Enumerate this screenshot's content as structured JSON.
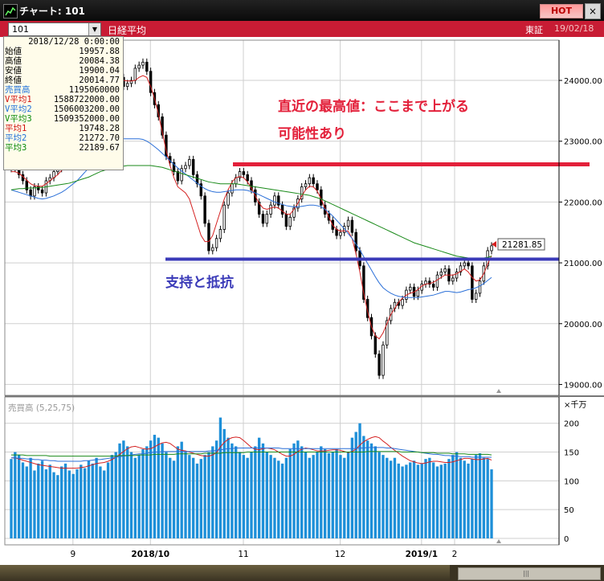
{
  "window": {
    "title": "チャート: 101",
    "hot_badge": "HOT",
    "close": "×"
  },
  "toolbar": {
    "symbol": "101",
    "index_name": "日経平均",
    "market": "東証",
    "date": "19/02/18"
  },
  "info_panel": {
    "date": "2018/12/28 0:00:00",
    "rows": [
      {
        "label": "始値",
        "value": "19957.88",
        "color": "#000000"
      },
      {
        "label": "高値",
        "value": "20084.38",
        "color": "#000000"
      },
      {
        "label": "安値",
        "value": "19900.04",
        "color": "#000000"
      },
      {
        "label": "終値",
        "value": "20014.77",
        "color": "#000000"
      },
      {
        "label": "売買高",
        "value": "1195060000",
        "color": "#1e6fd9"
      },
      {
        "label": "V平均1",
        "value": "1588722000.00",
        "color": "#d01010"
      },
      {
        "label": "V平均2",
        "value": "1506003200.00",
        "color": "#1e6fd9"
      },
      {
        "label": "V平均3",
        "value": "1509352000.00",
        "color": "#0a8a0a"
      },
      {
        "label": "平均1",
        "value": "19748.28",
        "color": "#d01010"
      },
      {
        "label": "平均2",
        "value": "21272.70",
        "color": "#1e6fd9"
      },
      {
        "label": "平均3",
        "value": "22189.67",
        "color": "#0a8a0a"
      }
    ]
  },
  "annotations": {
    "resistance_text_line1": "直近の最高値：ここまで上がる",
    "resistance_text_line2": "可能性あり",
    "support_text": "支持と抵抗",
    "current_price": "21281.85"
  },
  "colors": {
    "resistance": "#e3203a",
    "support": "#3a3ab8",
    "candle": "#d42020",
    "ma_short": "#d42020",
    "ma_mid": "#2a6fd8",
    "ma_long": "#1a8a1a",
    "volume": "#1d8fd8",
    "grid": "#cfcfcf"
  },
  "chart_data": [
    {
      "type": "candlestick",
      "title": "",
      "x_tick_labels": [
        "9",
        "2018/10",
        "11",
        "12",
        "2019/1",
        "2"
      ],
      "y_tick_labels": [
        "24000.00",
        "23000.00",
        "22000.00",
        "21000.00",
        "20000.00",
        "19000.00"
      ],
      "ylim": [
        18900,
        24450
      ],
      "grid": true,
      "lines": [
        {
          "name": "resistance",
          "value": 22620
        },
        {
          "name": "support",
          "value": 21060
        }
      ],
      "ohlc_close": [
        22550,
        22650,
        22450,
        22350,
        22200,
        22100,
        22250,
        22200,
        22150,
        22350,
        22400,
        22500,
        22550,
        22600,
        22800,
        22850,
        22650,
        22750,
        23000,
        23250,
        23350,
        23500,
        23600,
        23700,
        23800,
        23900,
        24000,
        24100,
        24050,
        23900,
        23950,
        24000,
        24200,
        24250,
        24300,
        24150,
        23800,
        23600,
        23400,
        23100,
        22750,
        22650,
        22500,
        22350,
        22550,
        22600,
        22700,
        22450,
        22300,
        22100,
        21650,
        21200,
        21250,
        21400,
        21550,
        21950,
        22150,
        22300,
        22400,
        22500,
        22450,
        22350,
        22200,
        22000,
        21800,
        21650,
        21800,
        21950,
        22100,
        21950,
        21800,
        21600,
        21750,
        21900,
        22050,
        22250,
        22300,
        22400,
        22300,
        22200,
        21950,
        21800,
        21700,
        21550,
        21450,
        21500,
        21600,
        21700,
        21500,
        21200,
        20950,
        20400,
        20100,
        19800,
        19500,
        19150,
        19650,
        20050,
        20250,
        20350,
        20300,
        20400,
        20550,
        20600,
        20450,
        20550,
        20650,
        20700,
        20650,
        20600,
        20800,
        20850,
        20900,
        20700,
        20750,
        20850,
        20950,
        21000,
        20950,
        20400,
        20500,
        20700,
        20950,
        21200,
        21280
      ],
      "ma_short": [
        22500,
        22500,
        22470,
        22420,
        22360,
        22300,
        22270,
        22260,
        22260,
        22300,
        22350,
        22400,
        22450,
        22520,
        22600,
        22680,
        22720,
        22780,
        22880,
        23000,
        23130,
        23280,
        23420,
        23560,
        23680,
        23790,
        23880,
        23960,
        24000,
        24000,
        23990,
        23990,
        24000,
        24050,
        24080,
        24050,
        23900,
        23700,
        23450,
        23150,
        22850,
        22600,
        22400,
        22250,
        22200,
        22150,
        22050,
        21850,
        21650,
        21450,
        21350,
        21350,
        21450,
        21650,
        21850,
        22050,
        22200,
        22330,
        22400,
        22420,
        22400,
        22330,
        22230,
        22100,
        21980,
        21900,
        21880,
        21900,
        21920,
        21900,
        21850,
        21800,
        21800,
        21880,
        21980,
        22100,
        22200,
        22260,
        22250,
        22180,
        22050,
        21900,
        21750,
        21620,
        21550,
        21520,
        21530,
        21520,
        21400,
        21150,
        20850,
        20500,
        20200,
        19950,
        19800,
        19750,
        19850,
        20000,
        20150,
        20250,
        20350,
        20420,
        20470,
        20500,
        20520,
        20560,
        20620,
        20650,
        20660,
        20680,
        20720,
        20760,
        20800,
        20800,
        20800,
        20820,
        20860,
        20900,
        20850,
        20760,
        20700,
        20720,
        20820,
        20980,
        21120
      ],
      "ma_mid": [
        22200,
        22180,
        22160,
        22140,
        22120,
        22100,
        22080,
        22060,
        22050,
        22060,
        22080,
        22100,
        22130,
        22160,
        22200,
        22250,
        22300,
        22350,
        22420,
        22490,
        22560,
        22640,
        22720,
        22790,
        22860,
        22920,
        22970,
        23010,
        23030,
        23040,
        23040,
        23040,
        23040,
        23040,
        23030,
        23000,
        22960,
        22910,
        22860,
        22800,
        22740,
        22680,
        22620,
        22560,
        22510,
        22460,
        22410,
        22360,
        22310,
        22260,
        22220,
        22190,
        22170,
        22160,
        22160,
        22170,
        22180,
        22190,
        22200,
        22200,
        22200,
        22190,
        22170,
        22150,
        22120,
        22090,
        22060,
        22030,
        22000,
        21980,
        21960,
        21940,
        21930,
        21920,
        21920,
        21930,
        21940,
        21950,
        21950,
        21940,
        21920,
        21880,
        21830,
        21770,
        21700,
        21630,
        21560,
        21480,
        21400,
        21310,
        21210,
        21100,
        20990,
        20880,
        20770,
        20670,
        20590,
        20540,
        20500,
        20470,
        20450,
        20440,
        20430,
        20430,
        20430,
        20430,
        20440,
        20450,
        20460,
        20470,
        20490,
        20510,
        20530,
        20530,
        20520,
        20510,
        20520,
        20540,
        20560,
        20570,
        20590,
        20620,
        20660,
        20710,
        20760
      ],
      "ma_long": [
        22200,
        22210,
        22220,
        22220,
        22230,
        22230,
        22230,
        22240,
        22240,
        22250,
        22260,
        22270,
        22280,
        22290,
        22300,
        22310,
        22330,
        22350,
        22370,
        22390,
        22410,
        22440,
        22470,
        22500,
        22520,
        22540,
        22560,
        22570,
        22580,
        22590,
        22600,
        22600,
        22600,
        22600,
        22600,
        22600,
        22600,
        22590,
        22580,
        22570,
        22550,
        22530,
        22510,
        22490,
        22470,
        22450,
        22430,
        22410,
        22390,
        22370,
        22350,
        22330,
        22320,
        22310,
        22300,
        22300,
        22300,
        22300,
        22300,
        22290,
        22280,
        22270,
        22260,
        22250,
        22240,
        22230,
        22220,
        22210,
        22200,
        22190,
        22180,
        22170,
        22160,
        22150,
        22140,
        22130,
        22120,
        22110,
        22090,
        22070,
        22050,
        22020,
        21990,
        21960,
        21930,
        21900,
        21870,
        21840,
        21810,
        21780,
        21750,
        21720,
        21690,
        21660,
        21630,
        21600,
        21570,
        21540,
        21510,
        21480,
        21450,
        21420,
        21390,
        21360,
        21330,
        21310,
        21290,
        21270,
        21250,
        21230,
        21210,
        21190,
        21170,
        21150,
        21130,
        21110,
        21100,
        21090,
        21080,
        21070,
        21070,
        21070,
        21080,
        21090,
        21110
      ]
    },
    {
      "type": "bar",
      "title": "売買高 (5,25,75)",
      "unit": "×千万",
      "y_tick_labels": [
        "200",
        "150",
        "100",
        "50",
        "0"
      ],
      "ylim": [
        0,
        215
      ],
      "values": [
        138,
        150,
        145,
        132,
        125,
        140,
        118,
        130,
        135,
        120,
        128,
        115,
        110,
        125,
        130,
        118,
        112,
        120,
        128,
        122,
        135,
        130,
        140,
        125,
        118,
        132,
        145,
        150,
        165,
        170,
        160,
        150,
        140,
        145,
        155,
        160,
        170,
        180,
        175,
        165,
        150,
        140,
        135,
        160,
        168,
        150,
        145,
        140,
        130,
        138,
        145,
        150,
        160,
        170,
        210,
        190,
        175,
        165,
        160,
        150,
        145,
        140,
        150,
        160,
        175,
        165,
        150,
        145,
        140,
        135,
        130,
        140,
        155,
        165,
        170,
        160,
        150,
        140,
        145,
        150,
        160,
        155,
        148,
        150,
        155,
        145,
        140,
        150,
        175,
        185,
        200,
        178,
        170,
        165,
        160,
        150,
        145,
        140,
        135,
        140,
        130,
        125,
        128,
        132,
        135,
        128,
        130,
        138,
        140,
        132,
        125,
        128,
        130,
        138,
        145,
        150,
        140,
        135,
        130,
        138,
        145,
        148,
        140,
        138,
        120
      ],
      "ma_short": [
        140,
        140,
        138,
        136,
        134,
        132,
        130,
        128,
        127,
        126,
        125,
        124,
        123,
        122,
        122,
        122,
        122,
        122,
        123,
        124,
        126,
        128,
        130,
        131,
        132,
        134,
        137,
        141,
        146,
        151,
        156,
        159,
        160,
        158,
        156,
        155,
        156,
        159,
        163,
        166,
        167,
        165,
        160,
        155,
        153,
        152,
        150,
        148,
        146,
        144,
        143,
        143,
        145,
        149,
        159,
        167,
        172,
        175,
        176,
        175,
        170,
        164,
        158,
        155,
        154,
        156,
        157,
        156,
        154,
        150,
        146,
        143,
        143,
        146,
        151,
        155,
        157,
        156,
        154,
        152,
        152,
        152,
        153,
        154,
        154,
        153,
        151,
        149,
        151,
        155,
        162,
        168,
        172,
        175,
        177,
        175,
        169,
        164,
        158,
        153,
        148,
        143,
        139,
        135,
        133,
        131,
        130,
        131,
        133,
        134,
        134,
        133,
        132,
        132,
        133,
        135,
        137,
        139,
        139,
        138,
        137,
        137,
        138,
        139,
        136
      ],
      "ma_mid": [
        140,
        140,
        139,
        139,
        138,
        138,
        137,
        137,
        136,
        136,
        135,
        135,
        134,
        134,
        134,
        134,
        134,
        134,
        134,
        135,
        135,
        136,
        137,
        137,
        138,
        139,
        140,
        141,
        142,
        143,
        144,
        145,
        146,
        147,
        147,
        148,
        149,
        150,
        150,
        151,
        151,
        151,
        151,
        151,
        151,
        151,
        151,
        151,
        151,
        151,
        151,
        152,
        152,
        153,
        154,
        155,
        156,
        156,
        157,
        157,
        157,
        157,
        157,
        157,
        157,
        157,
        157,
        157,
        157,
        157,
        156,
        156,
        156,
        156,
        156,
        156,
        156,
        156,
        156,
        156,
        156,
        156,
        156,
        156,
        156,
        156,
        156,
        156,
        156,
        156,
        157,
        157,
        158,
        158,
        158,
        158,
        158,
        157,
        157,
        156,
        155,
        154,
        153,
        152,
        151,
        150,
        149,
        148,
        147,
        146,
        146,
        145,
        144,
        144,
        143,
        143,
        142,
        142,
        142,
        141,
        141,
        141,
        141,
        141,
        141
      ],
      "ma_long": [
        145,
        145,
        145,
        145,
        144,
        144,
        144,
        144,
        144,
        144,
        143,
        143,
        143,
        143,
        143,
        143,
        143,
        143,
        143,
        143,
        143,
        143,
        143,
        143,
        143,
        143,
        143,
        143,
        144,
        144,
        144,
        144,
        144,
        145,
        145,
        145,
        145,
        146,
        146,
        146,
        146,
        146,
        146,
        147,
        147,
        147,
        147,
        147,
        147,
        147,
        148,
        148,
        148,
        148,
        148,
        149,
        149,
        149,
        149,
        149,
        149,
        150,
        150,
        150,
        150,
        150,
        150,
        150,
        150,
        150,
        150,
        150,
        150,
        150,
        150,
        150,
        150,
        150,
        150,
        150,
        150,
        150,
        150,
        150,
        150,
        150,
        150,
        150,
        150,
        150,
        150,
        150,
        151,
        151,
        151,
        151,
        151,
        151,
        151,
        151,
        151,
        150,
        150,
        150,
        150,
        150,
        149,
        149,
        149,
        149,
        148,
        148,
        148,
        148,
        147,
        147,
        147,
        147,
        146,
        146,
        146,
        146,
        146,
        146,
        145
      ]
    }
  ]
}
